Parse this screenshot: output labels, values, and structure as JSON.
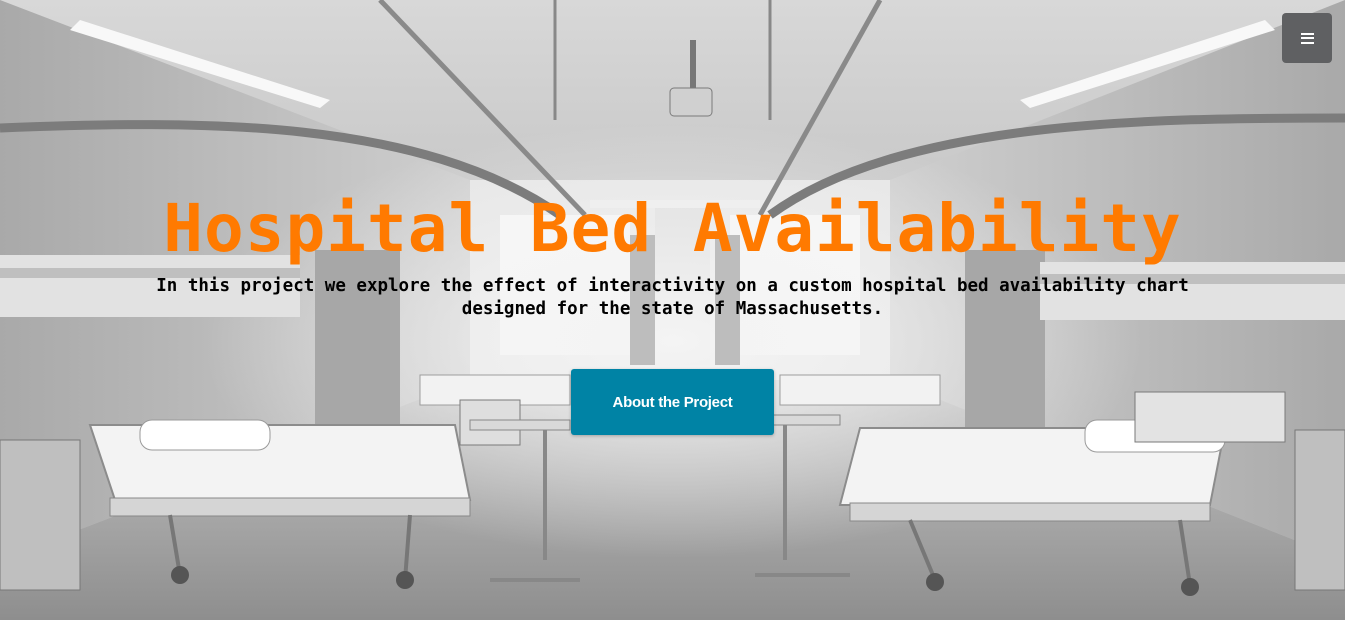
{
  "hero": {
    "title": "Hospital Bed Availability",
    "subtitle_line1": "In this project we explore the effect of interactivity on a custom hospital bed availability chart",
    "subtitle_line2": "designed for the state of Massachusetts.",
    "cta_label": "About the Project",
    "background_image": "hospital-ward-photo"
  },
  "nav": {
    "menu_icon": "hamburger-icon"
  },
  "colors": {
    "title": "#ff7a00",
    "cta_background": "#0083a5",
    "menu_button": "#5f6062"
  }
}
